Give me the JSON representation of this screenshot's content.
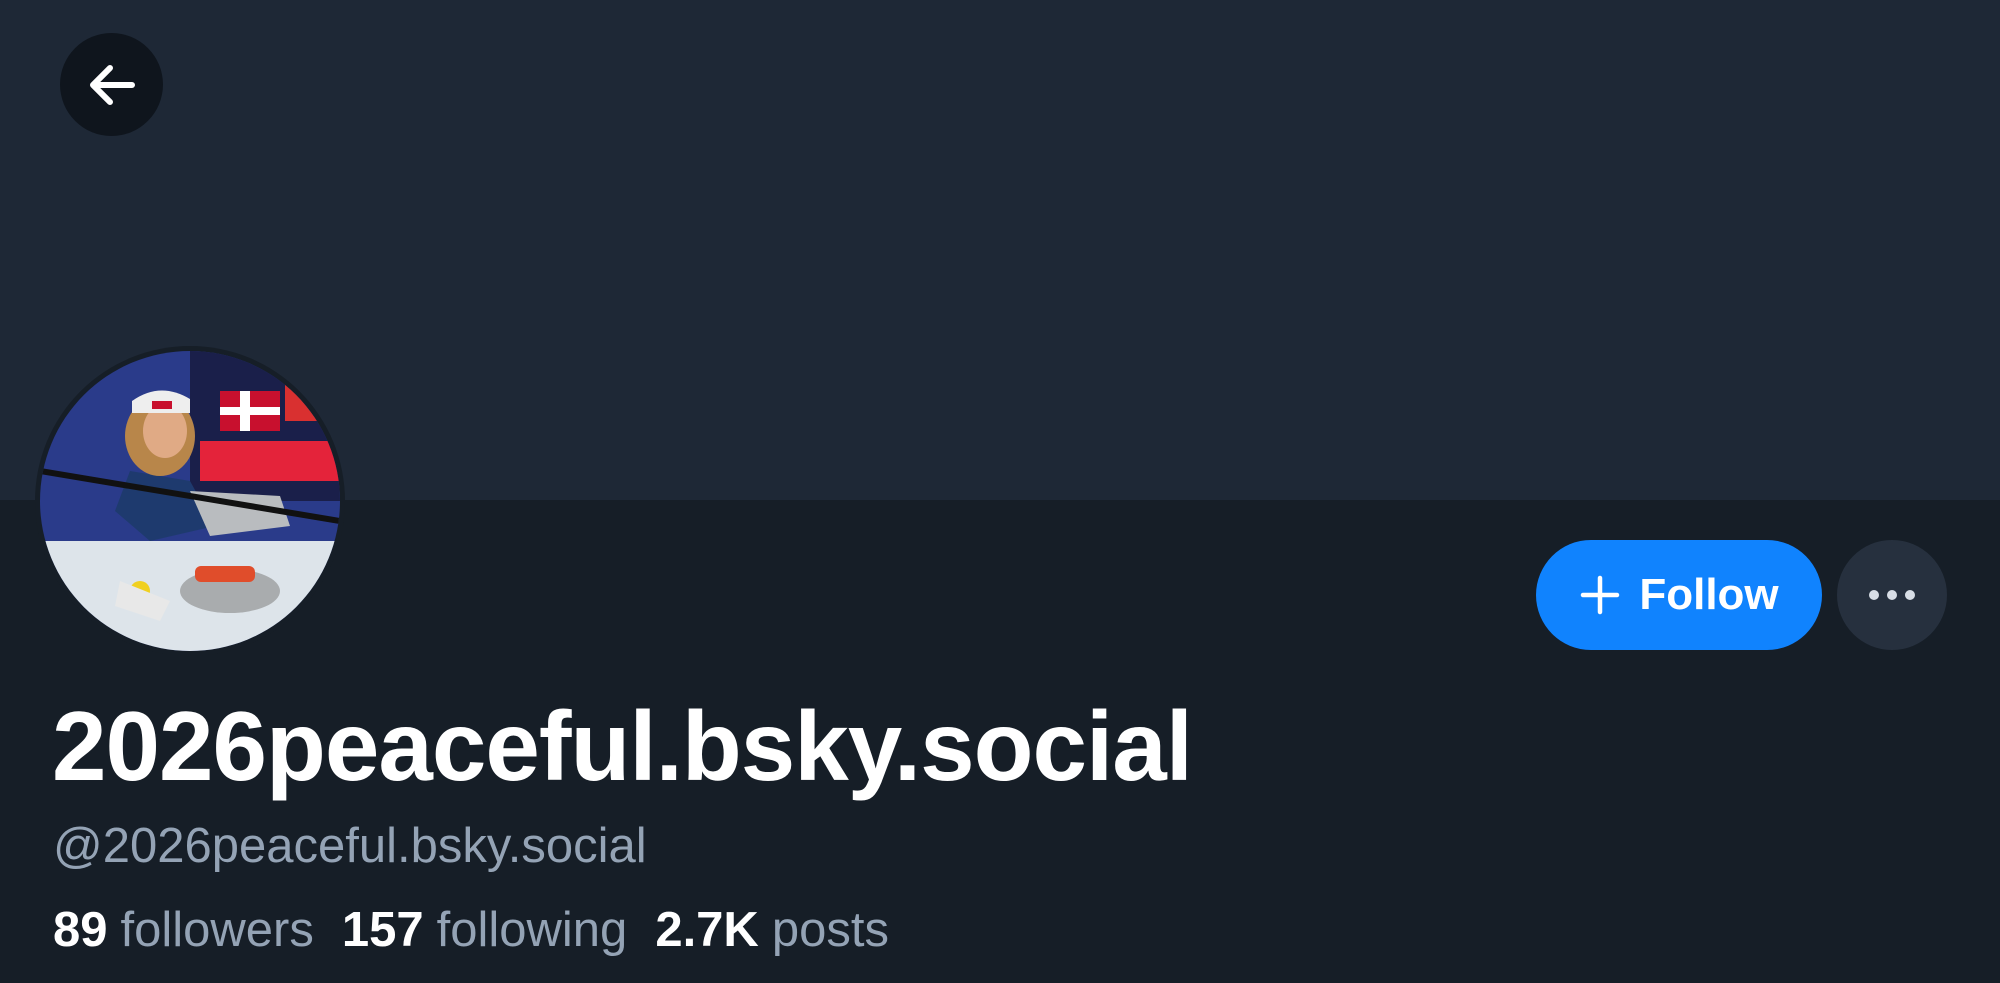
{
  "profile": {
    "display_name": "2026peaceful.bsky.social",
    "handle": "@2026peaceful.bsky.social"
  },
  "actions": {
    "follow_label": "Follow"
  },
  "stats": {
    "followers_count": "89",
    "followers_label": "followers",
    "following_count": "157",
    "following_label": "following",
    "posts_count": "2.7K",
    "posts_label": "posts"
  },
  "icons": {
    "back": "arrow-left-icon",
    "follow": "plus-icon",
    "more": "ellipsis-icon"
  },
  "colors": {
    "background": "#161e27",
    "banner": "#1e2836",
    "accent": "#1083fe",
    "muted_text": "#94a3b5"
  }
}
